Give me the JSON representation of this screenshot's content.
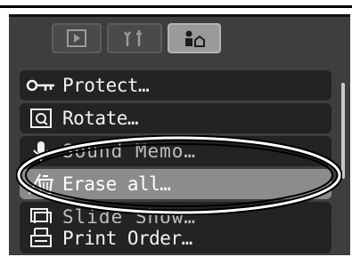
{
  "tabs": [
    {
      "name": "playback",
      "icon": "play-icon",
      "active": false
    },
    {
      "name": "tools",
      "icon": "tools-icon",
      "active": false
    },
    {
      "name": "my-menu",
      "icon": "my-menu-icon",
      "active": true
    }
  ],
  "menu": {
    "items": [
      {
        "label": "Protect…",
        "icon": "key-icon"
      },
      {
        "label": "Rotate…",
        "icon": "rotate-icon"
      },
      {
        "label": "Sound Memo…",
        "icon": "microphone-icon"
      },
      {
        "label": "Erase all…",
        "icon": "erase-all-icon",
        "selected": true
      },
      {
        "label": "Slide Show…",
        "icon": "slideshow-icon"
      },
      {
        "label": "Print Order…",
        "icon": "print-order-icon"
      }
    ]
  },
  "colors": {
    "screen": "#3e3e3e",
    "row": "#232323",
    "selected_row": "#8c8c8c",
    "highlight_ring": "#000000"
  }
}
